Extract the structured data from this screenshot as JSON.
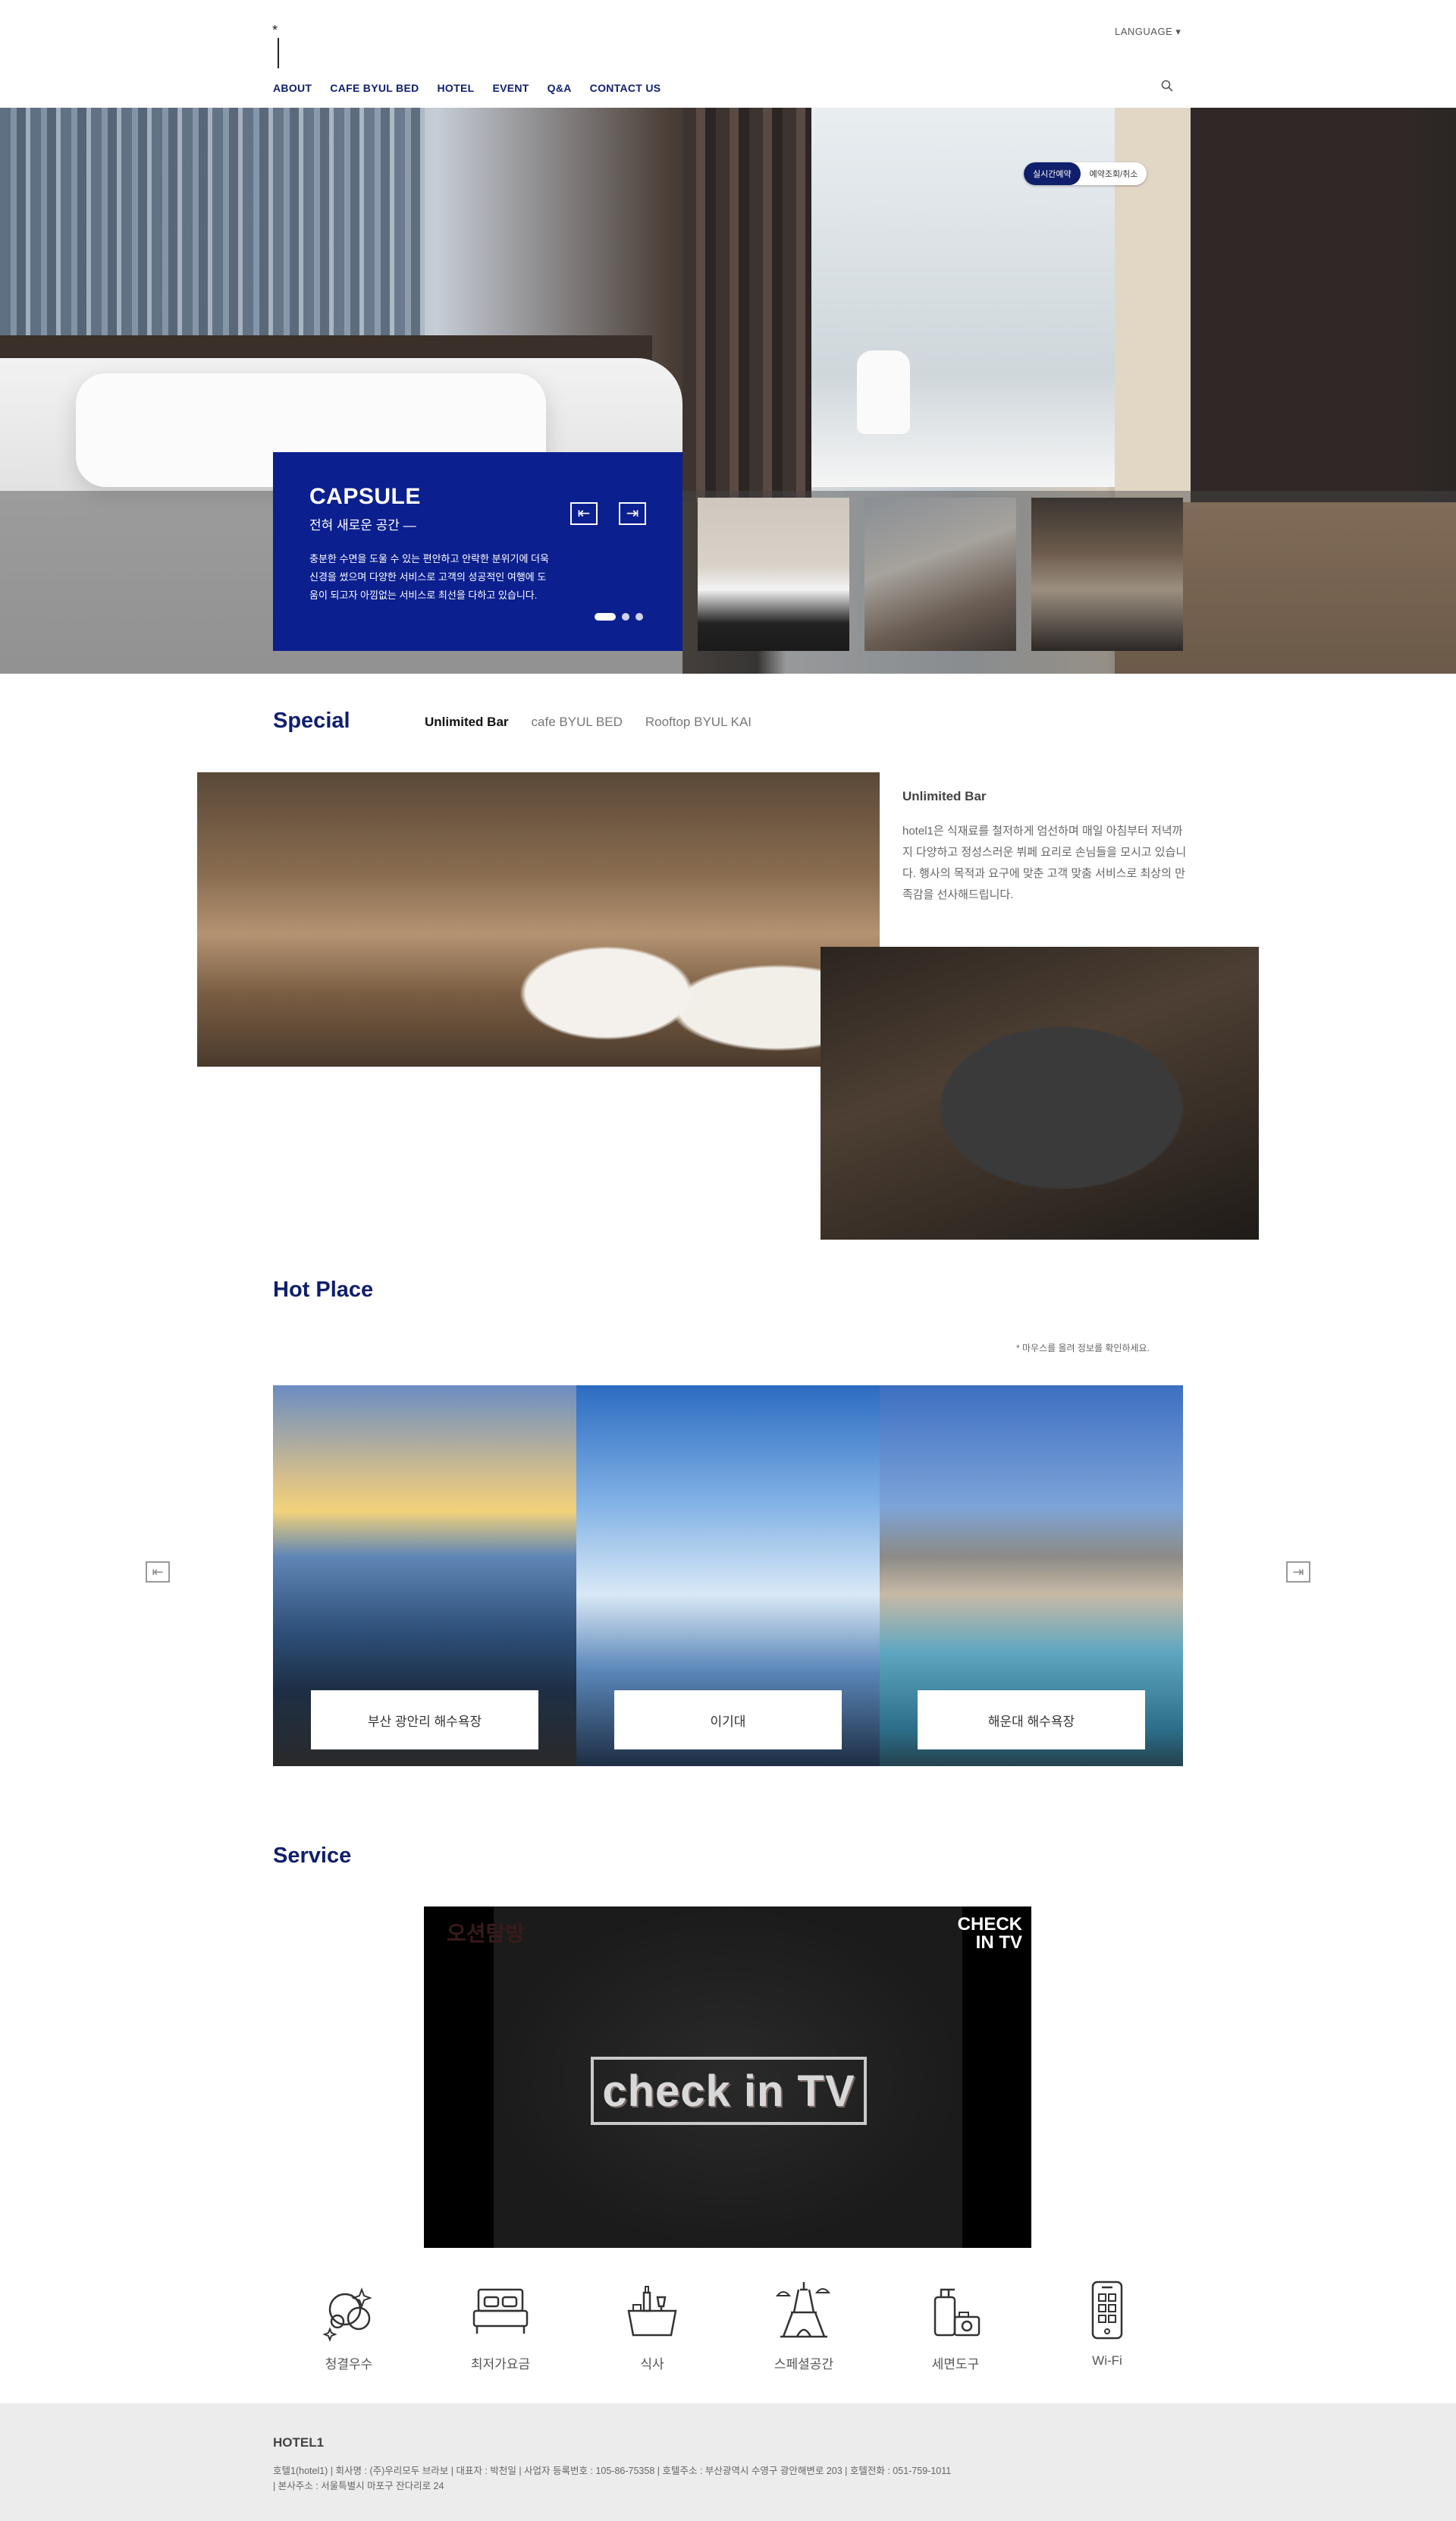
{
  "header": {
    "logo_mark": "*",
    "language": "LANGUAGE ▾",
    "nav": [
      "ABOUT",
      "CAFE BYUL BED",
      "HOTEL",
      "EVENT",
      "Q&A",
      "CONTACT US"
    ]
  },
  "hero": {
    "reservation_tabs": {
      "active": "실시간예약",
      "inactive": "예약조회/취소"
    },
    "slide": {
      "title": "CAPSULE",
      "subtitle": "전혀 새로운 공간 —",
      "body": "충분한 수면을 도울 수 있는 편안하고 안락한 분위기에 더욱 신경을 썼으며 다양한 서비스로 고객의 성공적인 여행에 도움이 되고자 아낌없는 서비스로 최선을 다하고 있습니다."
    },
    "arrows": {
      "prev": "⇤",
      "next": "⇥"
    }
  },
  "special": {
    "title": "Special",
    "tabs": [
      "Unlimited Bar",
      "cafe BYUL BED",
      "Rooftop BYUL KAI"
    ],
    "active_tab": "Unlimited Bar",
    "heading": "Unlimited Bar",
    "body": "hotel1은 식재료를 철저하게 엄선하며 매일 아침부터 저녁까지 다양하고 정성스러운 뷔페 요리로 손님들을 모시고 있습니다. 행사의 목적과 요구에 맞춘 고객 맞춤 서비스로 최상의 만족감을 선사해드립니다."
  },
  "hot_place": {
    "title": "Hot Place",
    "hint": "* 마우스를 올려 정보를 확인하세요.",
    "cards": [
      "부산 광안리 해수욕장",
      "이기대",
      "해운대 해수욕장"
    ],
    "arrows": {
      "prev": "⇤",
      "next": "⇥"
    }
  },
  "service": {
    "title": "Service",
    "video": {
      "corner": "CHECK IN TV",
      "logo": "check in TV",
      "mark": "오션탐방"
    },
    "items": [
      "청결우수",
      "최저가요금",
      "식사",
      "스페셜공간",
      "세면도구",
      "Wi-Fi"
    ]
  },
  "footer": {
    "brand": "HOTEL1",
    "line1": "호텔1(hotel1)  |  회사명 : (주)우리모두 브라보  |  대표자 : 박천일  |  사업자 등록번호 : 105-86-75358  |  호텔주소 : 부산광역시 수영구 광안해변로 203  |  호텔전화 : 051-759-1011",
    "line2": "|  본사주소 : 서울특별시 마포구 잔다리로 24"
  },
  "colors": {
    "brand_navy": "#0f1f6b",
    "slide_blue": "#0b1f8f",
    "footer_bg": "#ececec"
  }
}
